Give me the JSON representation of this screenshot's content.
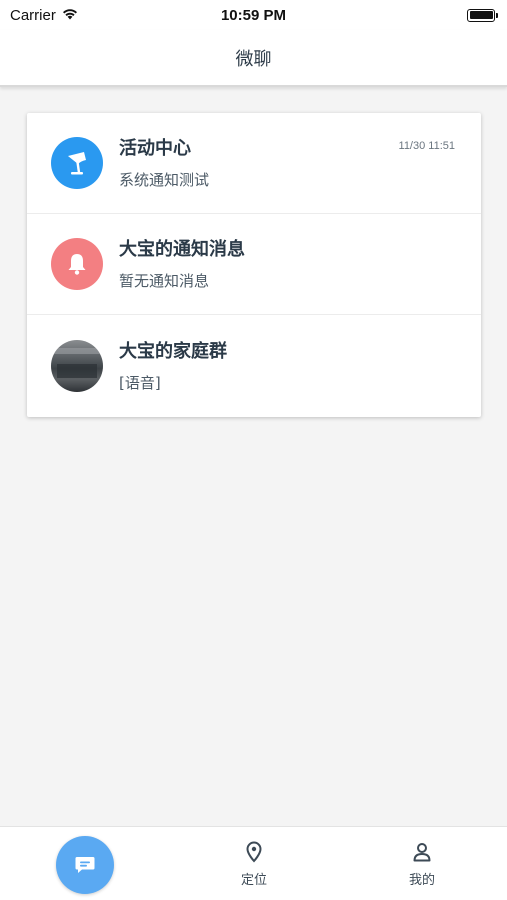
{
  "status_bar": {
    "carrier": "Carrier",
    "time": "10:59 PM"
  },
  "nav": {
    "title": "微聊"
  },
  "conversations": [
    {
      "title": "活动中心",
      "subtitle": "系统通知测试",
      "time": "11/30 11:51",
      "icon": "lamp-icon",
      "avatar_color": "#2a99f0"
    },
    {
      "title": "大宝的通知消息",
      "subtitle": "暂无通知消息",
      "icon": "bell-icon",
      "avatar_color": "#f37f82"
    },
    {
      "title": "大宝的家庭群",
      "subtitle": "[语音]",
      "icon": "group-photo-avatar"
    }
  ],
  "tabs": [
    {
      "label": "",
      "icon": "chat-icon",
      "active": true,
      "color": "#5aa9f2"
    },
    {
      "label": "定位",
      "icon": "location-pin-icon"
    },
    {
      "label": "我的",
      "icon": "person-icon"
    }
  ]
}
